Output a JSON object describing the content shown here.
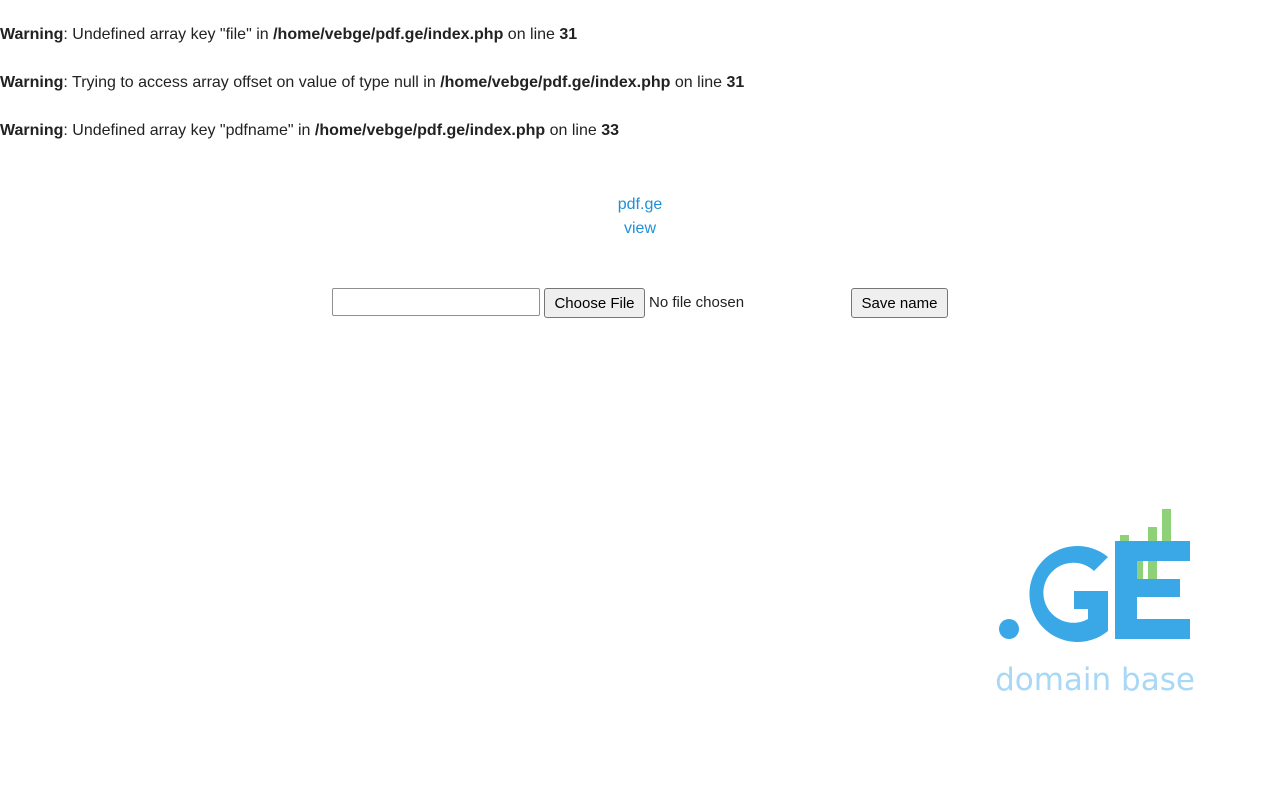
{
  "warnings": [
    {
      "label": "Warning",
      "message": ": Undefined array key \"file\" in ",
      "path": "/home/vebge/pdf.ge/index.php",
      "on_line_text": " on line ",
      "line": "31"
    },
    {
      "label": "Warning",
      "message": ": Trying to access array offset on value of type null in ",
      "path": "/home/vebge/pdf.ge/index.php",
      "on_line_text": " on line ",
      "line": "31"
    },
    {
      "label": "Warning",
      "message": ": Undefined array key \"pdfname\" in ",
      "path": "/home/vebge/pdf.ge/index.php",
      "on_line_text": " on line ",
      "line": "33"
    }
  ],
  "links": {
    "site": "pdf.ge",
    "view": "view"
  },
  "form": {
    "name_value": "",
    "choose_file_label": "Choose File",
    "no_file_text": "No file chosen",
    "save_label": "Save name"
  },
  "logo": {
    "mark_text": ".GE",
    "tagline": "domain base",
    "mark_color": "#3aa8e6",
    "bars_color": "#8fd178",
    "tagline_color": "#a8d8f5"
  },
  "colors": {
    "link": "#1e90d6",
    "text": "#222222"
  }
}
